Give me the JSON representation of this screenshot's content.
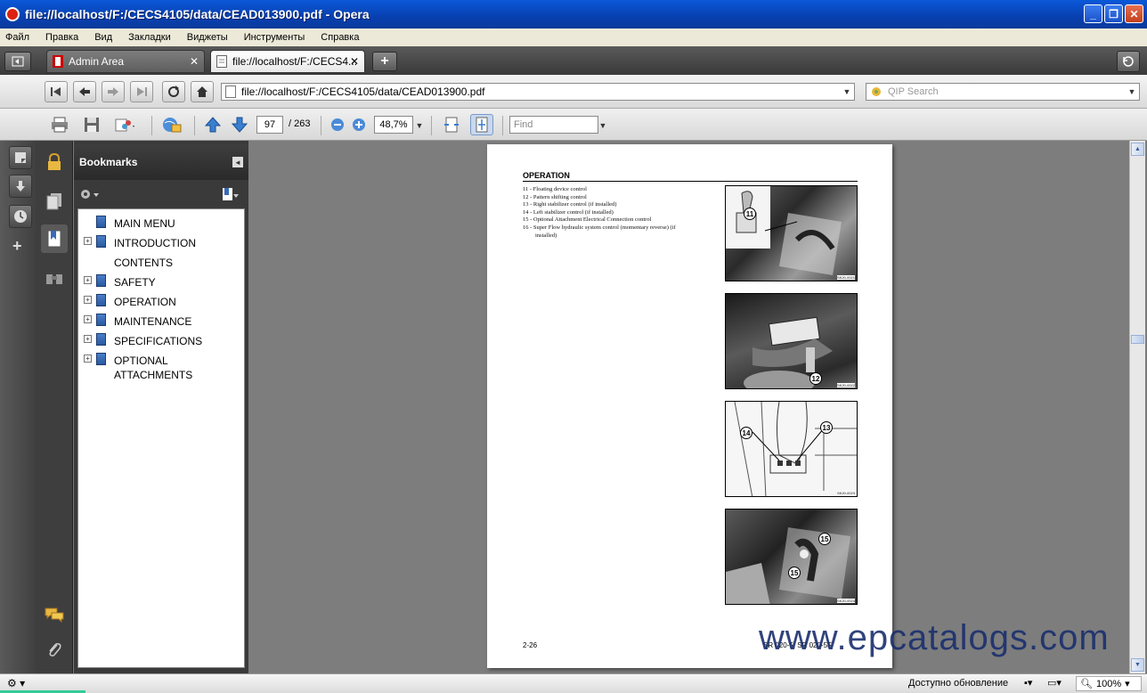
{
  "window": {
    "title": "file://localhost/F:/CECS4105/data/CEAD013900.pdf - Opera",
    "minimize": "_",
    "maximize": "❐",
    "close": "✕"
  },
  "menu": [
    "Файл",
    "Правка",
    "Вид",
    "Закладки",
    "Виджеты",
    "Инструменты",
    "Справка"
  ],
  "tabs": [
    {
      "label": "Admin Area",
      "close": "✕"
    },
    {
      "label": "file://localhost/F:/CECS4...",
      "close": "✕"
    }
  ],
  "address": {
    "url": "file://localhost/F:/CECS4105/data/CEAD013900.pdf",
    "search_placeholder": "QIP Search"
  },
  "pdf_toolbar": {
    "page": "97",
    "total": "/ 263",
    "zoom": "48,7%",
    "find_placeholder": "Find"
  },
  "bookmarks": {
    "title": "Bookmarks",
    "items": [
      {
        "label": "MAIN MENU",
        "expandable": false
      },
      {
        "label": "INTRODUCTION",
        "expandable": true
      },
      {
        "label": "CONTENTS",
        "expandable": false
      },
      {
        "label": "SAFETY",
        "expandable": true
      },
      {
        "label": "OPERATION",
        "expandable": true
      },
      {
        "label": "MAINTENANCE",
        "expandable": true
      },
      {
        "label": "SPECIFICATIONS",
        "expandable": true
      },
      {
        "label": "OPTIONAL ATTACHMENTS",
        "expandable": true
      }
    ]
  },
  "document": {
    "heading": "OPERATION",
    "list": [
      "11 - Floating device control",
      "12 - Pattern shifting control",
      "13 - Right stabilizer control (if installed)",
      "14 - Left stabilizer control (if installed)",
      "15 - Optional Attachment Electrical Connection control",
      "16 - Super Flow hydraulic system control (momentary reverse) (if",
      "      installed)"
    ],
    "footer_left": "2-26",
    "footer_right": "SR 020-5, SR 020-5F",
    "photos": [
      {
        "callouts": [
          "11"
        ],
        "code": "SK20-0021"
      },
      {
        "callouts": [
          "12"
        ],
        "code": "SK20-0022"
      },
      {
        "callouts": [
          "14",
          "13"
        ],
        "code": "SK20-0023"
      },
      {
        "callouts": [
          "15",
          "15"
        ],
        "code": "SK20-0024"
      }
    ]
  },
  "watermark": "www.epcatalogs.com",
  "status": {
    "update": "Доступно обновление",
    "zoom": "100%"
  }
}
